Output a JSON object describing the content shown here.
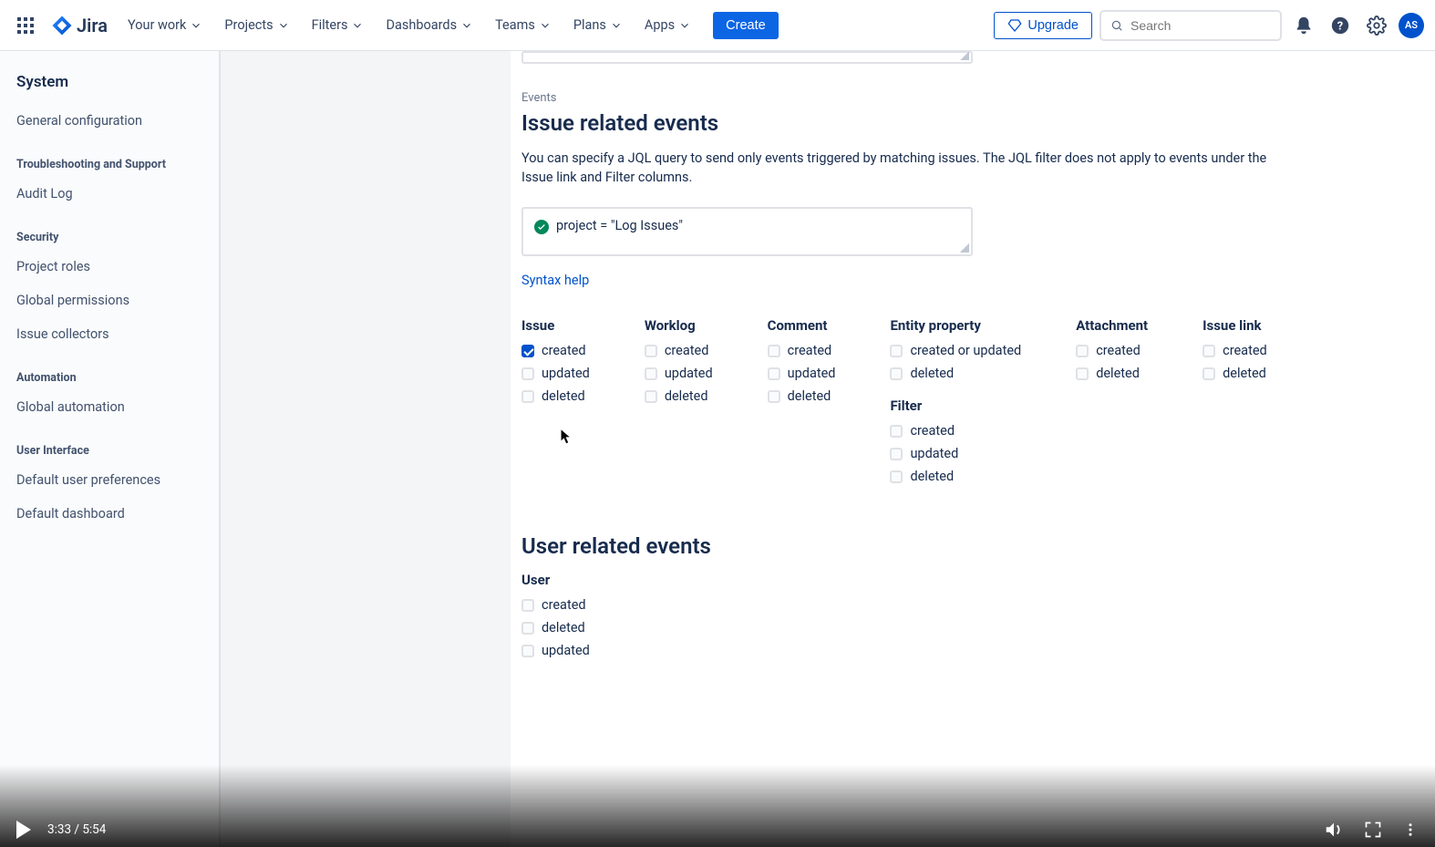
{
  "topnav": {
    "logo_text": "Jira",
    "items": [
      "Your work",
      "Projects",
      "Filters",
      "Dashboards",
      "Teams",
      "Plans",
      "Apps"
    ],
    "create": "Create",
    "upgrade": "Upgrade",
    "search_placeholder": "Search",
    "avatar_initials": "AS"
  },
  "sidebar": {
    "heading": "System",
    "groups": [
      {
        "items": [
          "General configuration"
        ]
      },
      {
        "title": "Troubleshooting and Support",
        "items": [
          "Audit Log"
        ]
      },
      {
        "title": "Security",
        "items": [
          "Project roles",
          "Global permissions",
          "Issue collectors"
        ]
      },
      {
        "title": "Automation",
        "items": [
          "Global automation"
        ]
      },
      {
        "title": "User Interface",
        "items": [
          "Default user preferences",
          "Default dashboard"
        ]
      }
    ]
  },
  "main": {
    "events_label": "Events",
    "issue_heading": "Issue related events",
    "issue_desc": "You can specify a JQL query to send only events triggered by matching issues. The JQL filter does not apply to events under the Issue link and Filter columns.",
    "jql_value": "project = \"Log Issues\"",
    "syntax_help": "Syntax help",
    "columns": {
      "issue": {
        "title": "Issue",
        "rows": [
          {
            "label": "created",
            "checked": true
          },
          {
            "label": "updated",
            "checked": false
          },
          {
            "label": "deleted",
            "checked": false
          }
        ]
      },
      "worklog": {
        "title": "Worklog",
        "rows": [
          {
            "label": "created",
            "checked": false
          },
          {
            "label": "updated",
            "checked": false
          },
          {
            "label": "deleted",
            "checked": false
          }
        ]
      },
      "comment": {
        "title": "Comment",
        "rows": [
          {
            "label": "created",
            "checked": false
          },
          {
            "label": "updated",
            "checked": false
          },
          {
            "label": "deleted",
            "checked": false
          }
        ]
      },
      "entity": {
        "title": "Entity property",
        "rows": [
          {
            "label": "created or updated",
            "checked": false
          },
          {
            "label": "deleted",
            "checked": false
          }
        ]
      },
      "filter": {
        "title": "Filter",
        "rows": [
          {
            "label": "created",
            "checked": false
          },
          {
            "label": "updated",
            "checked": false
          },
          {
            "label": "deleted",
            "checked": false
          }
        ]
      },
      "attachment": {
        "title": "Attachment",
        "rows": [
          {
            "label": "created",
            "checked": false
          },
          {
            "label": "deleted",
            "checked": false
          }
        ]
      },
      "issuelink": {
        "title": "Issue link",
        "rows": [
          {
            "label": "created",
            "checked": false
          },
          {
            "label": "deleted",
            "checked": false
          }
        ]
      }
    },
    "user_heading": "User related events",
    "user_col": {
      "title": "User",
      "rows": [
        {
          "label": "created",
          "checked": false
        },
        {
          "label": "deleted",
          "checked": false
        },
        {
          "label": "updated",
          "checked": false
        }
      ]
    }
  },
  "video": {
    "current": "3:33",
    "total": "5:54"
  }
}
